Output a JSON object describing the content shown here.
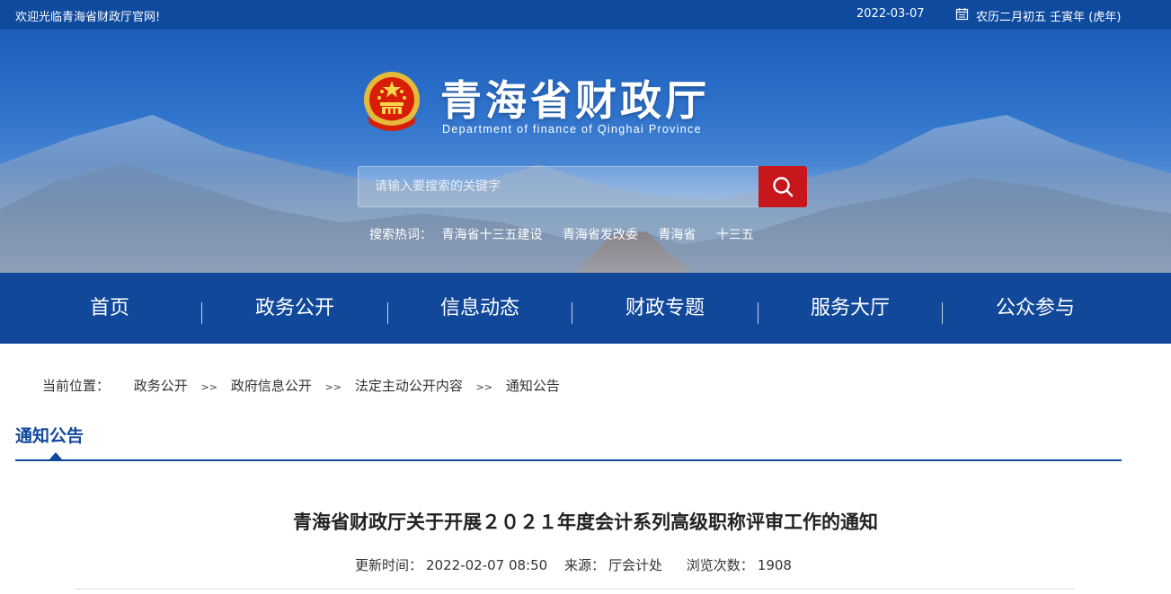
{
  "topbar": {
    "welcome": "欢迎光临青海省财政厅官网!",
    "date": "2022-03-07",
    "lunar": "农历二月初五 壬寅年 (虎年)",
    "calendar_icon": "calendar-icon"
  },
  "header": {
    "title": "青海省财政厅",
    "subtitle": "Department of finance of Qinghai Province",
    "emblem": "national-emblem-icon"
  },
  "search": {
    "placeholder": "请输入要搜索的关键字",
    "button_icon": "search-icon",
    "button_color": "#c8161d",
    "hot_label": "搜索热词：",
    "hot_words": [
      "青海省十三五建设",
      "青海省发改委",
      "青海省",
      "十三五"
    ]
  },
  "nav": {
    "items": [
      "首页",
      "政务公开",
      "信息动态",
      "财政专题",
      "服务大厅",
      "公众参与"
    ]
  },
  "breadcrumb": {
    "label": "当前位置：",
    "items": [
      "政务公开",
      "政府信息公开",
      "法定主动公开内容",
      "通知公告"
    ],
    "separator": ">>"
  },
  "section": {
    "title": "通知公告"
  },
  "article": {
    "title": "青海省财政厅关于开展２０２１年度会计系列高级职称评审工作的通知",
    "updated_label": "更新时间：",
    "updated_value": "2022-02-07 08:50",
    "source_label": "来源：",
    "source_value": "厅会计处",
    "views_label": "浏览次数：",
    "views_value": "1908"
  },
  "colors": {
    "primary": "#11489a",
    "topbar": "#0e4a9e",
    "accent": "#c8161d"
  }
}
